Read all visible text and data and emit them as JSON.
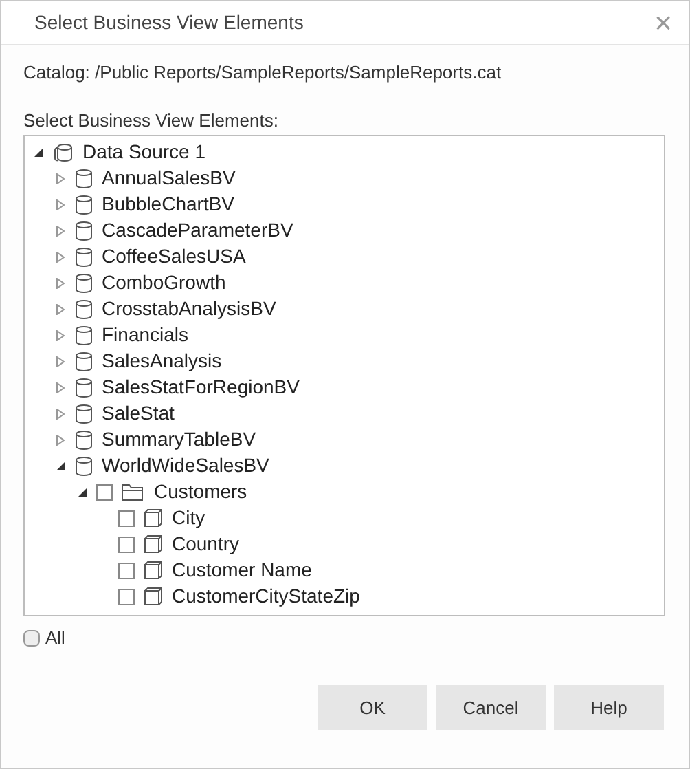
{
  "window": {
    "title": "Select Business View Elements",
    "close": "×"
  },
  "catalog": "Catalog: /Public Reports/SampleReports/SampleReports.cat",
  "tree_label": "Select Business View Elements:",
  "tree": [
    {
      "kind": "datasource",
      "label": "Data Source 1",
      "expanded": true,
      "children": [
        {
          "kind": "view",
          "label": "AnnualSalesBV",
          "expanded": false
        },
        {
          "kind": "view",
          "label": "BubbleChartBV",
          "expanded": false
        },
        {
          "kind": "view",
          "label": "CascadeParameterBV",
          "expanded": false
        },
        {
          "kind": "view",
          "label": "CoffeeSalesUSA",
          "expanded": false
        },
        {
          "kind": "view",
          "label": "ComboGrowth",
          "expanded": false
        },
        {
          "kind": "view",
          "label": "CrosstabAnalysisBV",
          "expanded": false
        },
        {
          "kind": "view",
          "label": "Financials",
          "expanded": false
        },
        {
          "kind": "view",
          "label": "SalesAnalysis",
          "expanded": false
        },
        {
          "kind": "view",
          "label": "SalesStatForRegionBV",
          "expanded": false
        },
        {
          "kind": "view",
          "label": "SaleStat",
          "expanded": false
        },
        {
          "kind": "view",
          "label": "SummaryTableBV",
          "expanded": false
        },
        {
          "kind": "view",
          "label": "WorldWideSalesBV",
          "expanded": true,
          "children": [
            {
              "kind": "folder",
              "label": "Customers",
              "expanded": true,
              "checked": false,
              "children": [
                {
                  "kind": "field",
                  "label": "City",
                  "checked": false
                },
                {
                  "kind": "field",
                  "label": "Country",
                  "checked": false
                },
                {
                  "kind": "field",
                  "label": "Customer Name",
                  "checked": false
                },
                {
                  "kind": "field",
                  "label": "CustomerCityStateZip",
                  "checked": false
                }
              ]
            }
          ]
        }
      ]
    }
  ],
  "all": {
    "label": "All",
    "checked": false
  },
  "buttons": [
    "OK",
    "Cancel",
    "Help"
  ]
}
